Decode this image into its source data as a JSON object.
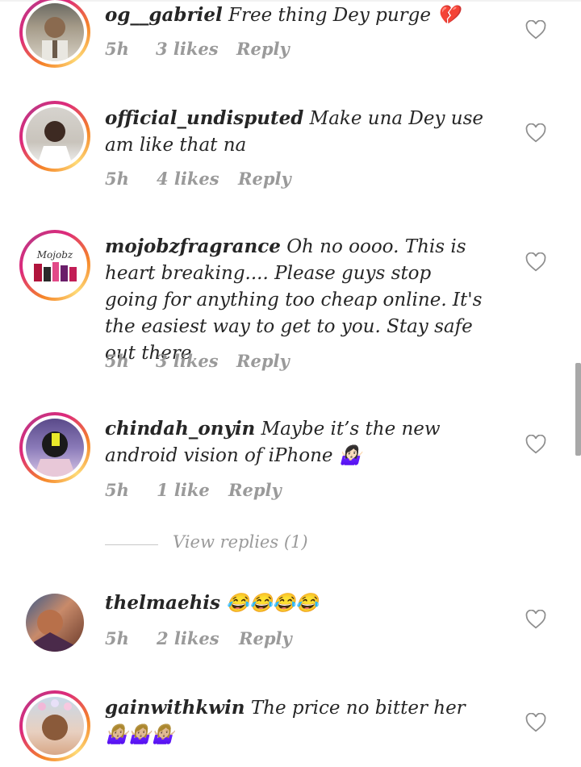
{
  "colors": {
    "meta": "#9a9a9a",
    "text": "#262626",
    "heart_outline": "#8e8e8e"
  },
  "comments": [
    {
      "username": "og__gabriel",
      "text": "Free thing Dey purge 💔",
      "time": "5h",
      "likes": "3 likes",
      "reply": "Reply",
      "has_story_ring": true
    },
    {
      "username": "official_undisputed",
      "text": "Make una Dey use am like that na",
      "time": "5h",
      "likes": "4 likes",
      "reply": "Reply",
      "has_story_ring": true
    },
    {
      "username": "mojobzfragrance",
      "text": "Oh no oooo. This is heart breaking.... Please guys stop going for anything too cheap online. It's the easiest way to get to you. Stay safe out there",
      "time": "5h",
      "likes": "3 likes",
      "reply": "Reply",
      "has_story_ring": true,
      "avatar_label": "Mojobz"
    },
    {
      "username": "chindah_onyin",
      "text": "Maybe it’s the new android vision of iPhone 🤷🏻‍♀",
      "time": "5h",
      "likes": "1 like",
      "reply": "Reply",
      "has_story_ring": true
    },
    {
      "username": "thelmaehis",
      "text": "😂😂😂😂",
      "time": "5h",
      "likes": "2 likes",
      "reply": "Reply",
      "has_story_ring": false
    },
    {
      "username": "gainwithkwin",
      "text": "The price no bitter her 🤷🏼‍♀🤷🏼‍♀🤷🏼‍♀",
      "time": "",
      "likes": "",
      "reply": "",
      "has_story_ring": true
    }
  ],
  "view_replies": "View replies (1)",
  "icons": {
    "like": "heart-outline-icon"
  }
}
